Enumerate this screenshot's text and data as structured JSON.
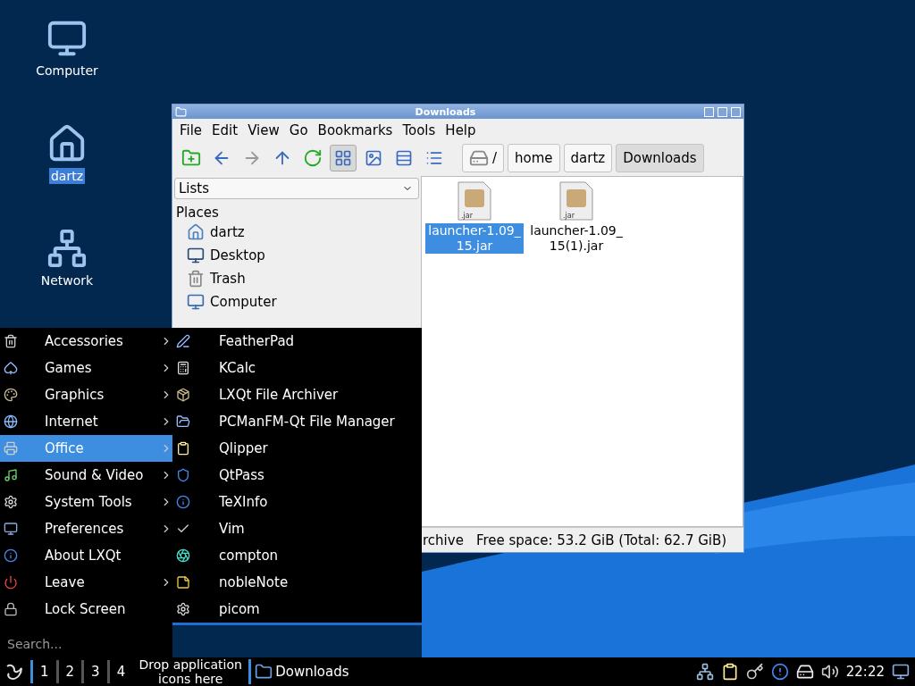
{
  "desktop_icons": [
    {
      "label": "Computer",
      "selected": false
    },
    {
      "label": "dartz",
      "selected": true
    },
    {
      "label": "Network",
      "selected": false
    }
  ],
  "window": {
    "title": "Downloads",
    "menu": [
      "File",
      "Edit",
      "View",
      "Go",
      "Bookmarks",
      "Tools",
      "Help"
    ],
    "view_modes": [
      {
        "selected": true
      },
      {
        "selected": false
      },
      {
        "selected": false
      },
      {
        "selected": false
      }
    ],
    "path": [
      {
        "label": "/",
        "selected": false
      },
      {
        "label": "home",
        "selected": false
      },
      {
        "label": "dartz",
        "selected": false
      },
      {
        "label": "Downloads",
        "selected": true
      }
    ],
    "side_pane": {
      "mode": "Lists",
      "heading": "Places",
      "items": [
        "dartz",
        "Desktop",
        "Trash",
        "Computer"
      ]
    },
    "files": [
      {
        "name": "launcher-1.09_15.jar",
        "badge": ".jar",
        "selected": true
      },
      {
        "name": "launcher-1.09_15(1).jar",
        "badge": ".jar",
        "selected": false
      }
    ],
    "status_bar": {
      "left": "rchive",
      "right": "Free space: 53.2 GiB (Total: 62.7 GiB)"
    }
  },
  "start_menu": {
    "items": [
      {
        "label": "Accessories",
        "submenu": true,
        "selected": false
      },
      {
        "label": "Games",
        "submenu": true,
        "selected": false
      },
      {
        "label": "Graphics",
        "submenu": true,
        "selected": false
      },
      {
        "label": "Internet",
        "submenu": true,
        "selected": false
      },
      {
        "label": "Office",
        "submenu": true,
        "selected": true
      },
      {
        "label": "Sound & Video",
        "submenu": true,
        "selected": false
      },
      {
        "label": "System Tools",
        "submenu": true,
        "selected": false
      },
      {
        "label": "Preferences",
        "submenu": true,
        "selected": false
      },
      {
        "label": "About LXQt",
        "submenu": false,
        "selected": false
      },
      {
        "label": "Leave",
        "submenu": true,
        "selected": false
      },
      {
        "label": "Lock Screen",
        "submenu": false,
        "selected": false
      }
    ],
    "search": {
      "placeholder": "Search..."
    },
    "submenu": [
      "FeatherPad",
      "KCalc",
      "LXQt File Archiver",
      "PCManFM-Qt File Manager",
      "Qlipper",
      "QtPass",
      "TeXInfo",
      "Vim",
      "compton",
      "nobleNote",
      "picom"
    ]
  },
  "taskbar": {
    "desktops": [
      {
        "label": "1",
        "selected": true
      },
      {
        "label": "2",
        "selected": false
      },
      {
        "label": "3",
        "selected": false
      },
      {
        "label": "4",
        "selected": false
      }
    ],
    "quicklaunch": "Drop application icons here",
    "tasks": [
      {
        "label": "Downloads"
      }
    ],
    "clock": "22:22"
  }
}
